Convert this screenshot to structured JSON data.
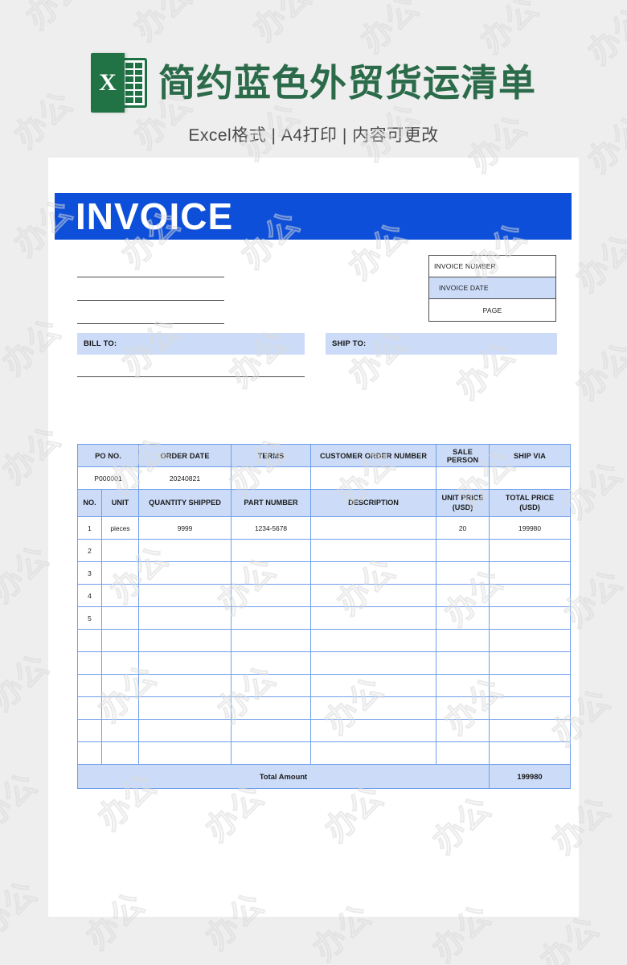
{
  "promo": {
    "icon_letter": "X",
    "icon_name": "excel-file-icon",
    "title": "简约蓝色外贸货运清单",
    "subtitle": "Excel格式 | A4打印 | 内容可更改"
  },
  "colors": {
    "banner_blue": "#0d4fd8",
    "fill_light_blue": "#ccdcf8",
    "table_border_blue": "#6d9eeb",
    "title_green": "#2b6b4a",
    "icon_green": "#217346",
    "page_bg": "#eeeeee"
  },
  "document": {
    "banner_title": "INVOICE",
    "meta_box": [
      {
        "label": "INVOICE NUMBER",
        "align": "left",
        "highlight": false
      },
      {
        "label": "INVOICE DATE",
        "align": "indent",
        "highlight": true
      },
      {
        "label": "PAGE",
        "align": "center",
        "highlight": false
      }
    ],
    "bill_to_label": "BILL TO:",
    "ship_to_label": "SHIP TO:",
    "order_header": [
      "PO NO.",
      "ORDER DATE",
      "TERMS",
      "CUSTOMER ORDER NUMBER",
      "SALE PERSON",
      "SHIP VIA"
    ],
    "order_values": [
      "P000001",
      "20240821",
      "",
      "",
      "",
      ""
    ],
    "item_header": [
      "NO.",
      "UNIT",
      "QUANTITY SHIPPED",
      "PART NUMBER",
      "DESCRIPTION",
      "UNIT PRICE\n(USD)",
      "TOTAL PRICE\n(USD)"
    ],
    "item_header_line1": [
      "NO.",
      "UNIT",
      "QUANTITY SHIPPED",
      "PART NUMBER",
      "DESCRIPTION",
      "UNIT PRICE",
      "TOTAL PRICE"
    ],
    "item_header_line2": [
      "",
      "",
      "",
      "",
      "",
      "(USD)",
      "(USD)"
    ],
    "rows": [
      {
        "no": "1",
        "unit": "pieces",
        "qty": "9999",
        "part": "1234-5678",
        "desc": "",
        "unit_price": "20",
        "total_price": "199980"
      },
      {
        "no": "2",
        "unit": "",
        "qty": "",
        "part": "",
        "desc": "",
        "unit_price": "",
        "total_price": ""
      },
      {
        "no": "3",
        "unit": "",
        "qty": "",
        "part": "",
        "desc": "",
        "unit_price": "",
        "total_price": ""
      },
      {
        "no": "4",
        "unit": "",
        "qty": "",
        "part": "",
        "desc": "",
        "unit_price": "",
        "total_price": ""
      },
      {
        "no": "5",
        "unit": "",
        "qty": "",
        "part": "",
        "desc": "",
        "unit_price": "",
        "total_price": ""
      },
      {
        "no": "",
        "unit": "",
        "qty": "",
        "part": "",
        "desc": "",
        "unit_price": "",
        "total_price": ""
      },
      {
        "no": "",
        "unit": "",
        "qty": "",
        "part": "",
        "desc": "",
        "unit_price": "",
        "total_price": ""
      },
      {
        "no": "",
        "unit": "",
        "qty": "",
        "part": "",
        "desc": "",
        "unit_price": "",
        "total_price": ""
      },
      {
        "no": "",
        "unit": "",
        "qty": "",
        "part": "",
        "desc": "",
        "unit_price": "",
        "total_price": ""
      },
      {
        "no": "",
        "unit": "",
        "qty": "",
        "part": "",
        "desc": "",
        "unit_price": "",
        "total_price": ""
      },
      {
        "no": "",
        "unit": "",
        "qty": "",
        "part": "",
        "desc": "",
        "unit_price": "",
        "total_price": ""
      }
    ],
    "total_label": "Total Amount",
    "total_value": "199980"
  },
  "watermark": {
    "text": "办公"
  }
}
